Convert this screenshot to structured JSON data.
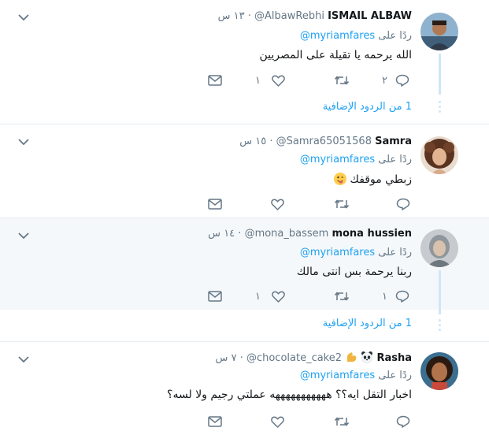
{
  "reply_label": "ردًا على",
  "mention": "@myriamfares",
  "more_replies": "1 من الردود الإضافية",
  "tweets": [
    {
      "name": "ISMAIL ALBAW",
      "handle": "@AlbawRebhi",
      "time": "١٣ س",
      "text": "الله يرحمه يا تقيلة على المصريين",
      "replies": "٢",
      "retweets": "",
      "likes": "١",
      "avatar_color": "#6f8aa3",
      "show_more": true
    },
    {
      "name": "Samra",
      "handle": "@Samra65051568",
      "time": "١٥ س",
      "text": "زبطي موقفك",
      "text_emoji": "winking-face-tongue",
      "replies": "",
      "retweets": "",
      "likes": "",
      "avatar_color": "#7a4a2e",
      "show_more": false
    },
    {
      "name": "mona hussien",
      "handle": "@mona_bassem",
      "time": "١٤ س",
      "text": "ربنا يرحمة بس انتى مالك",
      "replies": "١",
      "retweets": "",
      "likes": "١",
      "avatar_color": "#9aa0a6",
      "show_more": true
    },
    {
      "name": "Rasha",
      "name_emojis": [
        "panda-face",
        "flexed-biceps"
      ],
      "handle": "@chocolate_cake2",
      "time": "٧ س",
      "text": "اخبار التقل ايه؟؟ هههههههههههه عملتي رجيم ولا لسه؟",
      "replies": "",
      "retweets": "",
      "likes": "",
      "avatar_color": "#5a3b2c",
      "show_more": false
    }
  ],
  "colors": {
    "link": "#1da1f2",
    "muted": "#657786",
    "separator": "#e6ecf0",
    "highlight": "#f5f8fa",
    "thread_line": "#cce7f7"
  }
}
